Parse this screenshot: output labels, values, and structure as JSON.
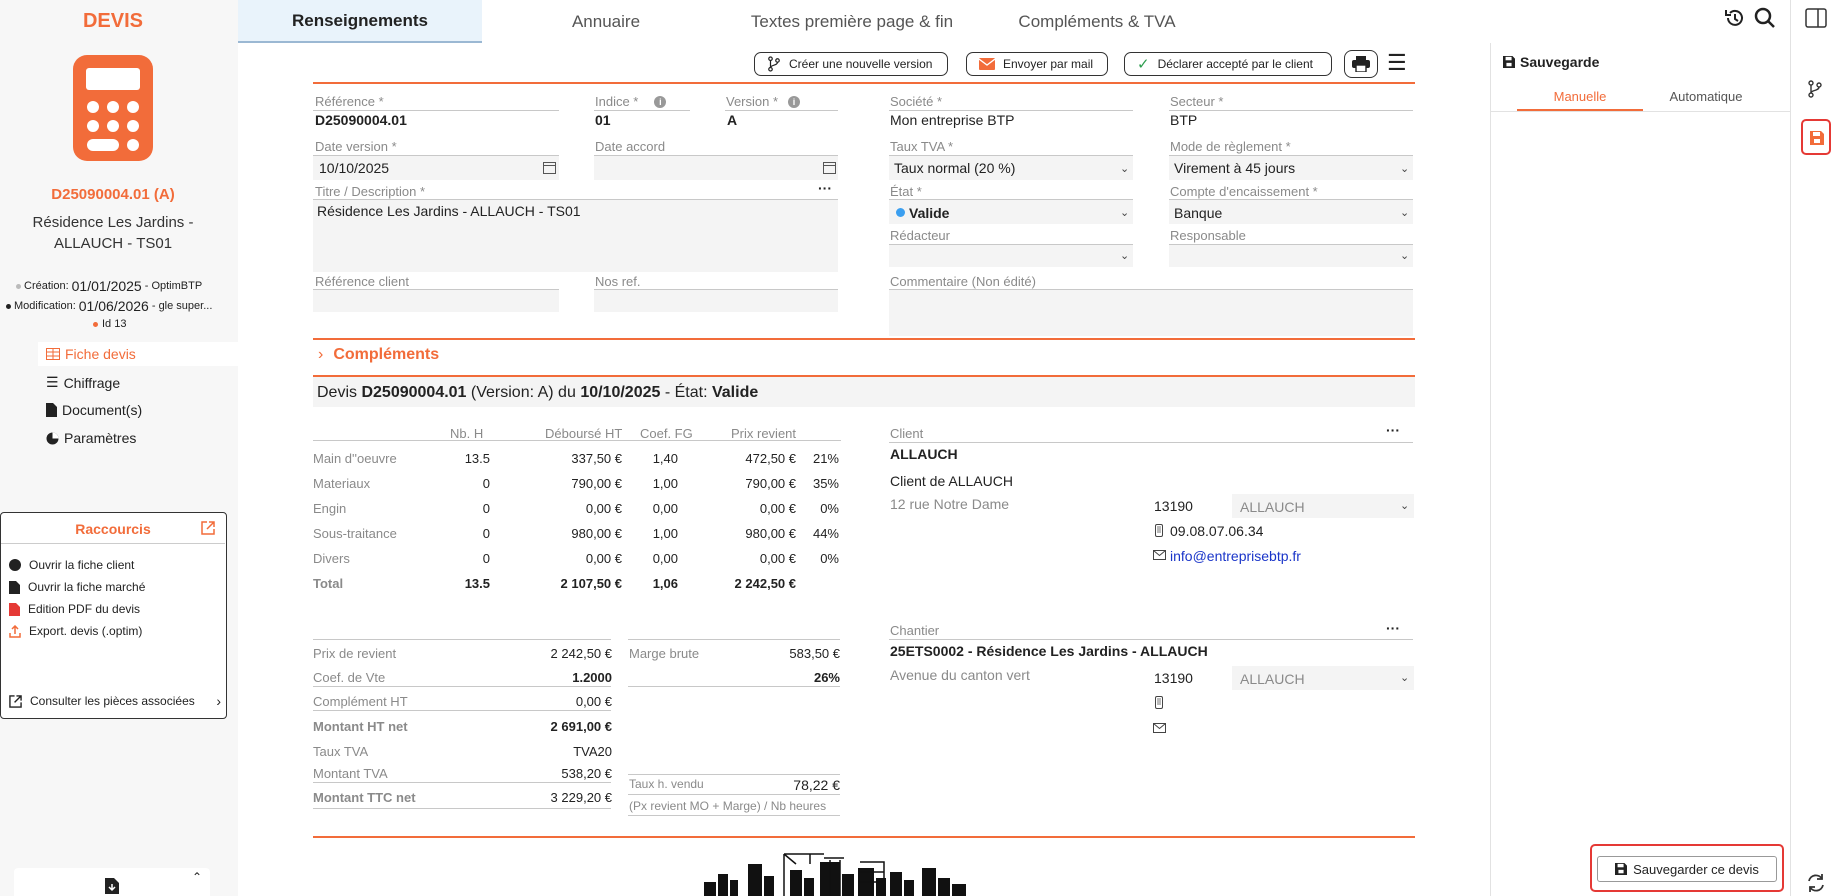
{
  "sidebar": {
    "app_title": "DEVIS",
    "devis_ref": "D25090004.01 (A)",
    "devis_desc": "Résidence Les Jardins - ALLAUCH - TS01",
    "creation_label": "Création:",
    "creation_date": "01/01/2025",
    "creation_user": "- OptimBTP",
    "modification_label": "Modification:",
    "modification_date": "01/06/2026",
    "modification_user": "- gle super...",
    "id_label": "Id 13",
    "nav": [
      "Fiche devis",
      "Chiffrage",
      "Document(s)",
      "Paramètres"
    ],
    "shortcuts_title": "Raccourcis",
    "shortcuts": [
      "Ouvrir la fiche client",
      "Ouvrir la fiche marché",
      "Edition PDF du devis",
      "Export. devis (.optim)"
    ],
    "pieces_link": "Consulter les pièces associées"
  },
  "tabs": [
    "Renseignements",
    "Annuaire",
    "Textes première page & fin",
    "Compléments & TVA"
  ],
  "toolbar": {
    "new_version": "Créer une nouvelle version",
    "send_mail": "Envoyer par mail",
    "declare_accepted": "Déclarer accepté par le client"
  },
  "form": {
    "reference_label": "Référence *",
    "reference_value": "D25090004.01",
    "indice_label": "Indice *",
    "indice_value": "01",
    "version_label": "Version *",
    "version_value": "A",
    "date_version_label": "Date version *",
    "date_version_value": "10/10/2025",
    "date_accord_label": "Date accord",
    "titre_label": "Titre / Description *",
    "titre_value": "Résidence Les Jardins - ALLAUCH - TS01",
    "ref_client_label": "Référence client",
    "nos_ref_label": "Nos ref.",
    "societe_label": "Société *",
    "societe_value": "Mon entreprise BTP",
    "secteur_label": "Secteur *",
    "secteur_value": "BTP",
    "taux_tva_label": "Taux TVA *",
    "taux_tva_value": "Taux normal (20 %)",
    "mode_reglement_label": "Mode de règlement *",
    "mode_reglement_value": "Virement à 45 jours",
    "etat_label": "État *",
    "etat_value": "Valide",
    "compte_label": "Compte d'encaissement *",
    "compte_value": "Banque",
    "redacteur_label": "Rédacteur",
    "responsable_label": "Responsable",
    "commentaire_label": "Commentaire (Non édité)"
  },
  "complements_title": "Compléments",
  "summary": {
    "prefix": "Devis",
    "ref": "D25090004.01",
    "version_text": "(Version: A) du",
    "date": "10/10/2025",
    "etat_prefix": "- État:",
    "etat": "Valide"
  },
  "cost_table": {
    "headers": [
      "Nb. H",
      "Déboursé HT",
      "Coef. FG",
      "Prix revient"
    ],
    "rows": [
      {
        "label": "Main d''oeuvre",
        "nbh": "13.5",
        "debourse": "337,50 €",
        "coef": "1,40",
        "prix": "472,50 €",
        "pct": "21%"
      },
      {
        "label": "Materiaux",
        "nbh": "0",
        "debourse": "790,00 €",
        "coef": "1,00",
        "prix": "790,00 €",
        "pct": "35%"
      },
      {
        "label": "Engin",
        "nbh": "0",
        "debourse": "0,00 €",
        "coef": "0,00",
        "prix": "0,00 €",
        "pct": "0%"
      },
      {
        "label": "Sous-traitance",
        "nbh": "0",
        "debourse": "980,00 €",
        "coef": "1,00",
        "prix": "980,00 €",
        "pct": "44%"
      },
      {
        "label": "Divers",
        "nbh": "0",
        "debourse": "0,00 €",
        "coef": "0,00",
        "prix": "0,00 €",
        "pct": "0%"
      },
      {
        "label": "Total",
        "nbh": "13.5",
        "debourse": "2 107,50 €",
        "coef": "1,06",
        "prix": "2 242,50 €",
        "pct": ""
      }
    ]
  },
  "totals": {
    "prix_revient_label": "Prix de revient",
    "prix_revient": "2 242,50 €",
    "coef_vte_label": "Coef. de Vte",
    "coef_vte": "1.2000",
    "complement_label": "Complément HT",
    "complement": "0,00 €",
    "montant_ht_label": "Montant HT net",
    "montant_ht": "2 691,00 €",
    "taux_tva_label": "Taux TVA",
    "taux_tva": "TVA20",
    "montant_tva_label": "Montant TVA",
    "montant_tva": "538,20 €",
    "montant_ttc_label": "Montant TTC net",
    "montant_ttc": "3 229,20 €",
    "marge_label": "Marge brute",
    "marge": "583,50 €",
    "marge_pct": "26%",
    "taux_h_label": "Taux h. vendu",
    "taux_h": "78,22 €",
    "taux_h_note": "(Px revient MO + Marge) / Nb heures"
  },
  "client": {
    "label": "Client",
    "name": "ALLAUCH",
    "subname": "Client de ALLAUCH",
    "address": "12 rue Notre Dame",
    "postcode": "13190",
    "city": "ALLAUCH",
    "phone": "09.08.07.06.34",
    "email": "info@entreprisebtp.fr"
  },
  "chantier": {
    "label": "Chantier",
    "name": "25ETS0002 - Résidence Les Jardins - ALLAUCH",
    "address": "Avenue du canton vert",
    "postcode": "13190",
    "city": "ALLAUCH"
  },
  "right_panel": {
    "title": "Sauvegarde",
    "tab_manual": "Manuelle",
    "tab_auto": "Automatique",
    "save_button": "Sauvegarder ce devis"
  },
  "colors": {
    "accent": "#f26c3a",
    "valid_dot": "#3b9ff0",
    "link": "#1a35c9",
    "highlight": "#e53935"
  }
}
